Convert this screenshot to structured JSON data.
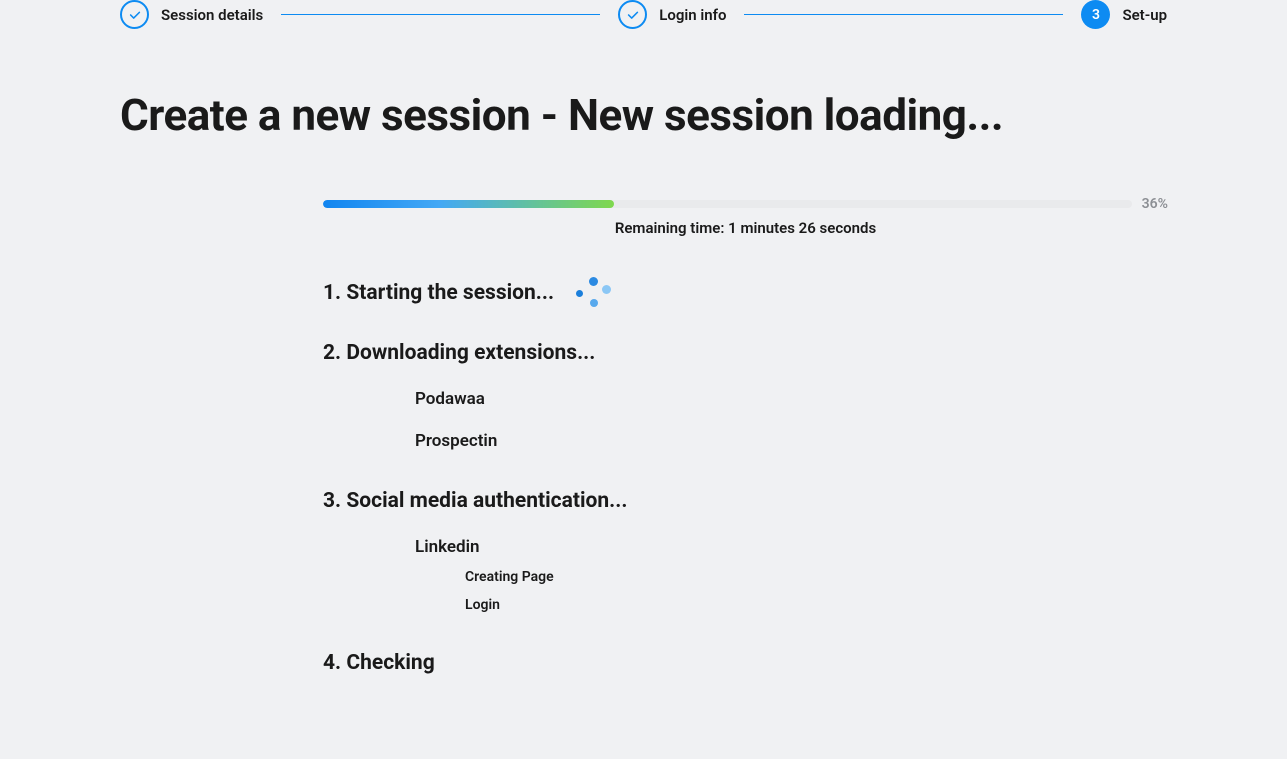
{
  "stepper": {
    "steps": [
      {
        "label": "Session details",
        "state": "done"
      },
      {
        "label": "Login info",
        "state": "done"
      },
      {
        "label": "Set-up",
        "state": "active",
        "number": "3"
      }
    ]
  },
  "page_title": "Create a new session - New session loading...",
  "progress": {
    "percent_label": "36%",
    "percent_value": 36,
    "remaining_time": "Remaining time: 1 minutes 26 seconds"
  },
  "tasks": [
    {
      "title": "1. Starting the session...",
      "spinner": true
    },
    {
      "title": "2. Downloading extensions...",
      "subs": [
        {
          "label": "Podawaa"
        },
        {
          "label": "Prospectin"
        }
      ]
    },
    {
      "title": "3. Social media authentication...",
      "subs": [
        {
          "label": "Linkedin",
          "subsubs": [
            {
              "label": "Creating Page"
            },
            {
              "label": "Login"
            }
          ]
        }
      ]
    },
    {
      "title": "4. Checking"
    }
  ]
}
